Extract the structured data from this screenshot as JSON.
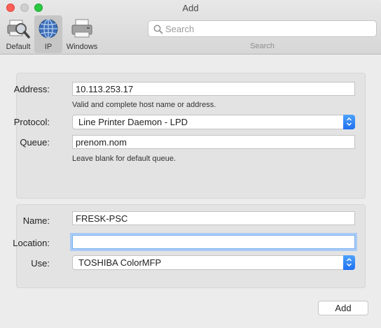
{
  "window": {
    "title": "Add"
  },
  "toolbar": {
    "tools": [
      {
        "label": "Default",
        "icon": "default-printers-icon"
      },
      {
        "label": "IP",
        "icon": "globe-icon",
        "selected": true
      },
      {
        "label": "Windows",
        "icon": "windows-printer-icon"
      }
    ],
    "search": {
      "placeholder": "Search",
      "caption": "Search"
    }
  },
  "ip_section": {
    "address_label": "Address:",
    "address_value": "10.113.253.17",
    "address_hint": "Valid and complete host name or address.",
    "protocol_label": "Protocol:",
    "protocol_value": "Line Printer Daemon - LPD",
    "queue_label": "Queue:",
    "queue_value": "prenom.nom",
    "queue_hint": "Leave blank for default queue."
  },
  "printer_section": {
    "name_label": "Name:",
    "name_value": "FRESK-PSC",
    "location_label": "Location:",
    "location_value": "",
    "use_label": "Use:",
    "use_value": "TOSHIBA ColorMFP"
  },
  "footer": {
    "add_label": "Add"
  },
  "colors": {
    "accent": "#2a7bf5",
    "close": "#fe5f57",
    "maximize": "#2bc840"
  }
}
